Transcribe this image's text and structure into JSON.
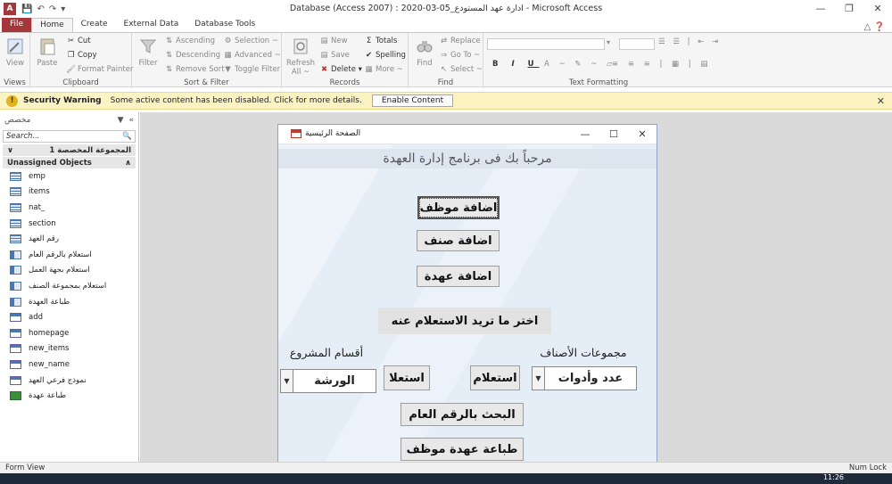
{
  "window": {
    "title": "Database (Access 2007) : ادارة عهد المستودع_05-03-2020 - Microsoft Access",
    "app_icon": "A",
    "qat": [
      "save-icon",
      "undo-icon",
      "redo-icon"
    ],
    "controls": [
      "—",
      "❐",
      "✕"
    ]
  },
  "tabs": [
    {
      "label": "File"
    },
    {
      "label": "Home"
    },
    {
      "label": "Create"
    },
    {
      "label": "External Data"
    },
    {
      "label": "Database Tools"
    }
  ],
  "ribbon": {
    "views": {
      "view_label": "View",
      "group": "Views"
    },
    "clipboard": {
      "paste": "Paste",
      "cut": "Cut",
      "copy": "Copy",
      "format_painter": "Format Painter",
      "group": "Clipboard"
    },
    "sort_filter": {
      "filter": "Filter",
      "ascending": "Ascending",
      "descending": "Descending",
      "remove_sort": "Remove Sort",
      "selection": "Selection ~",
      "advanced": "Advanced ~",
      "toggle_filter": "Toggle Filter",
      "group": "Sort & Filter"
    },
    "records": {
      "refresh": "Refresh",
      "refresh_all": "All ~",
      "new": "New",
      "save": "Save",
      "delete": "Delete",
      "totals": "Totals",
      "spelling": "Spelling",
      "more": "More ~",
      "group": "Records"
    },
    "find": {
      "find": "Find",
      "replace": "Replace",
      "goto": "Go To ~",
      "select": "Select ~",
      "group": "Find"
    },
    "text_formatting": {
      "group": "Text Formatting"
    }
  },
  "security": {
    "title": "Security Warning",
    "message": "Some active content has been disabled. Click for more details.",
    "button": "Enable Content"
  },
  "nav": {
    "header": "مخصص",
    "search_placeholder": "Search...",
    "group_custom": "المجموعة المخصصة 1",
    "group_unassigned": "Unassigned Objects",
    "items": [
      {
        "label": "emp",
        "type": "table"
      },
      {
        "label": "items",
        "type": "table"
      },
      {
        "label": "nat_",
        "type": "table"
      },
      {
        "label": "section",
        "type": "table"
      },
      {
        "label": "رقم العهد",
        "type": "table"
      },
      {
        "label": "استعلام بالرقم العام",
        "type": "query"
      },
      {
        "label": "استعلام بجهة العمل",
        "type": "query"
      },
      {
        "label": "استعلام بمجموعة الصنف",
        "type": "query"
      },
      {
        "label": "طباعة العهدة",
        "type": "query"
      },
      {
        "label": "add",
        "type": "form"
      },
      {
        "label": "homepage",
        "type": "form"
      },
      {
        "label": "new_items",
        "type": "form"
      },
      {
        "label": "new_name",
        "type": "form"
      },
      {
        "label": "نموذج فرعي العهد",
        "type": "form"
      },
      {
        "label": "طباعة عهدة",
        "type": "report"
      }
    ]
  },
  "form": {
    "title": "الصفحة الرئيسية",
    "welcome": "مرحباً بك فى برنامج إدارة العهدة",
    "btn_add_employee": "اضافة موظف",
    "btn_add_item": "اضافة صنف",
    "btn_add_custody": "اضافة عهدة",
    "query_header": "اختر ما تريد الاستعلام عنه",
    "label_groups": "مجموعات الأصناف",
    "label_sections": "أقسام المشروع",
    "combo_groups_value": "عدد وأدوات",
    "combo_sections_value": "الورشة",
    "btn_query_groups": "استعلام",
    "btn_query_sections": "استعلا",
    "btn_search_number": "البحث بالرقم العام",
    "btn_print_employee": "طباعة عهدة موظف"
  },
  "status": {
    "left": "Form View",
    "right": "Num Lock"
  },
  "taskbar": {
    "clock": "11:26"
  }
}
